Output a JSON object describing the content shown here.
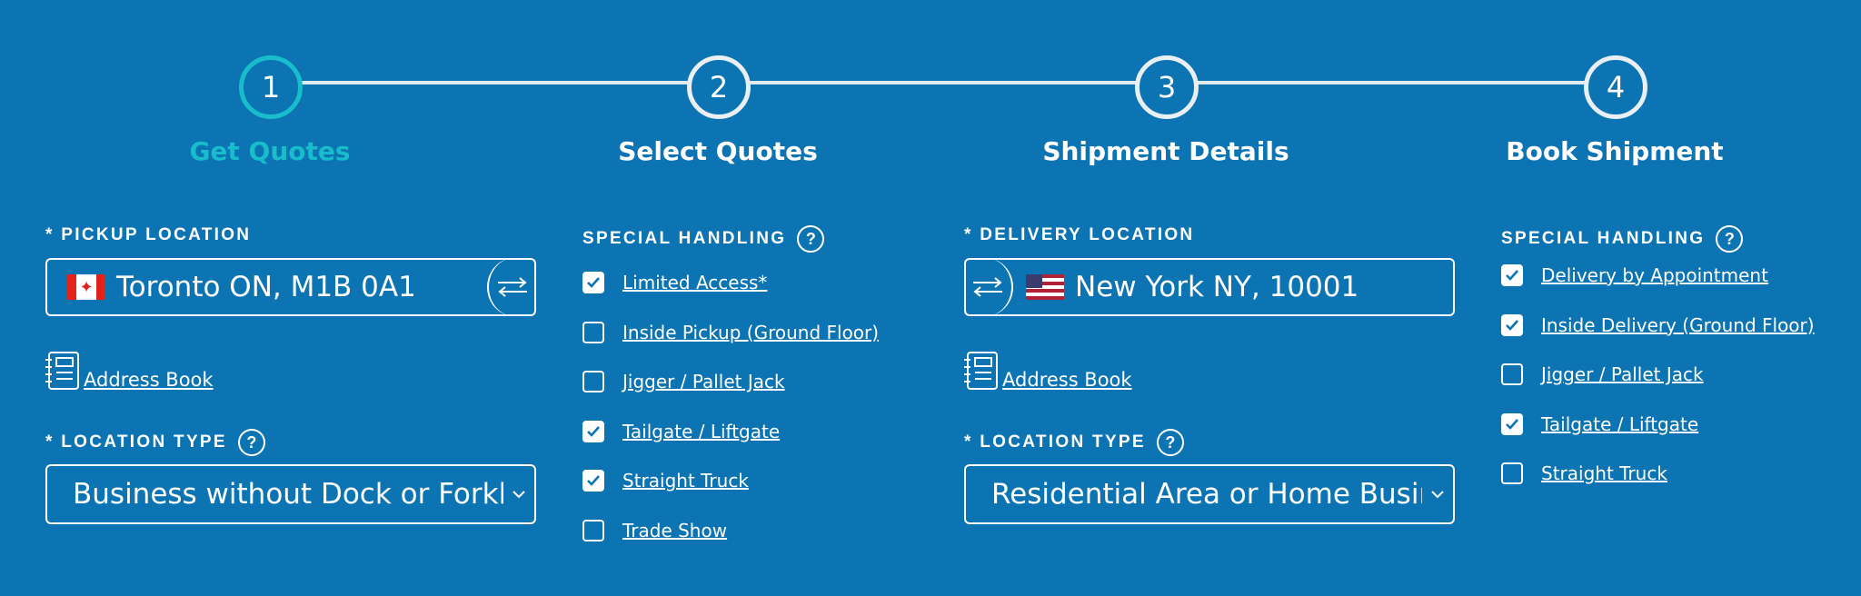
{
  "stepper": {
    "steps": [
      {
        "number": "1",
        "label": "Get Quotes",
        "active": true
      },
      {
        "number": "2",
        "label": "Select Quotes",
        "active": false
      },
      {
        "number": "3",
        "label": "Shipment Details",
        "active": false
      },
      {
        "number": "4",
        "label": "Book Shipment",
        "active": false
      }
    ]
  },
  "pickup": {
    "label": "* PICKUP LOCATION",
    "value": "Toronto ON, M1B 0A1",
    "flag_icon": "canada-flag-icon",
    "address_book": "Address Book",
    "location_type_label": "* LOCATION TYPE",
    "location_type_value": "Business without Dock or Forklift"
  },
  "pickup_handling": {
    "label": "SPECIAL HANDLING",
    "help": "?",
    "options": [
      {
        "label": "Limited Access*",
        "checked": true
      },
      {
        "label": "Inside Pickup (Ground Floor)",
        "checked": false
      },
      {
        "label": "Jigger / Pallet Jack",
        "checked": false
      },
      {
        "label": "Tailgate / Liftgate",
        "checked": true
      },
      {
        "label": "Straight Truck",
        "checked": true
      },
      {
        "label": "Trade Show",
        "checked": false
      }
    ]
  },
  "delivery": {
    "label": "* DELIVERY LOCATION",
    "value": "New York NY, 10001",
    "flag_icon": "usa-flag-icon",
    "address_book": "Address Book",
    "location_type_label": "* LOCATION TYPE",
    "location_type_value": "Residential Area or Home Business"
  },
  "delivery_handling": {
    "label": "SPECIAL HANDLING",
    "help": "?",
    "options": [
      {
        "label": "Delivery by Appointment",
        "checked": true
      },
      {
        "label": "Inside Delivery (Ground Floor)",
        "checked": true
      },
      {
        "label": "Jigger / Pallet Jack",
        "checked": false
      },
      {
        "label": "Tailgate / Liftgate",
        "checked": true
      },
      {
        "label": "Straight Truck",
        "checked": false
      }
    ]
  },
  "help_text": "?",
  "colors": {
    "background": "#0c74b3",
    "active_step": "#19bccb",
    "text": "#ffffff"
  }
}
